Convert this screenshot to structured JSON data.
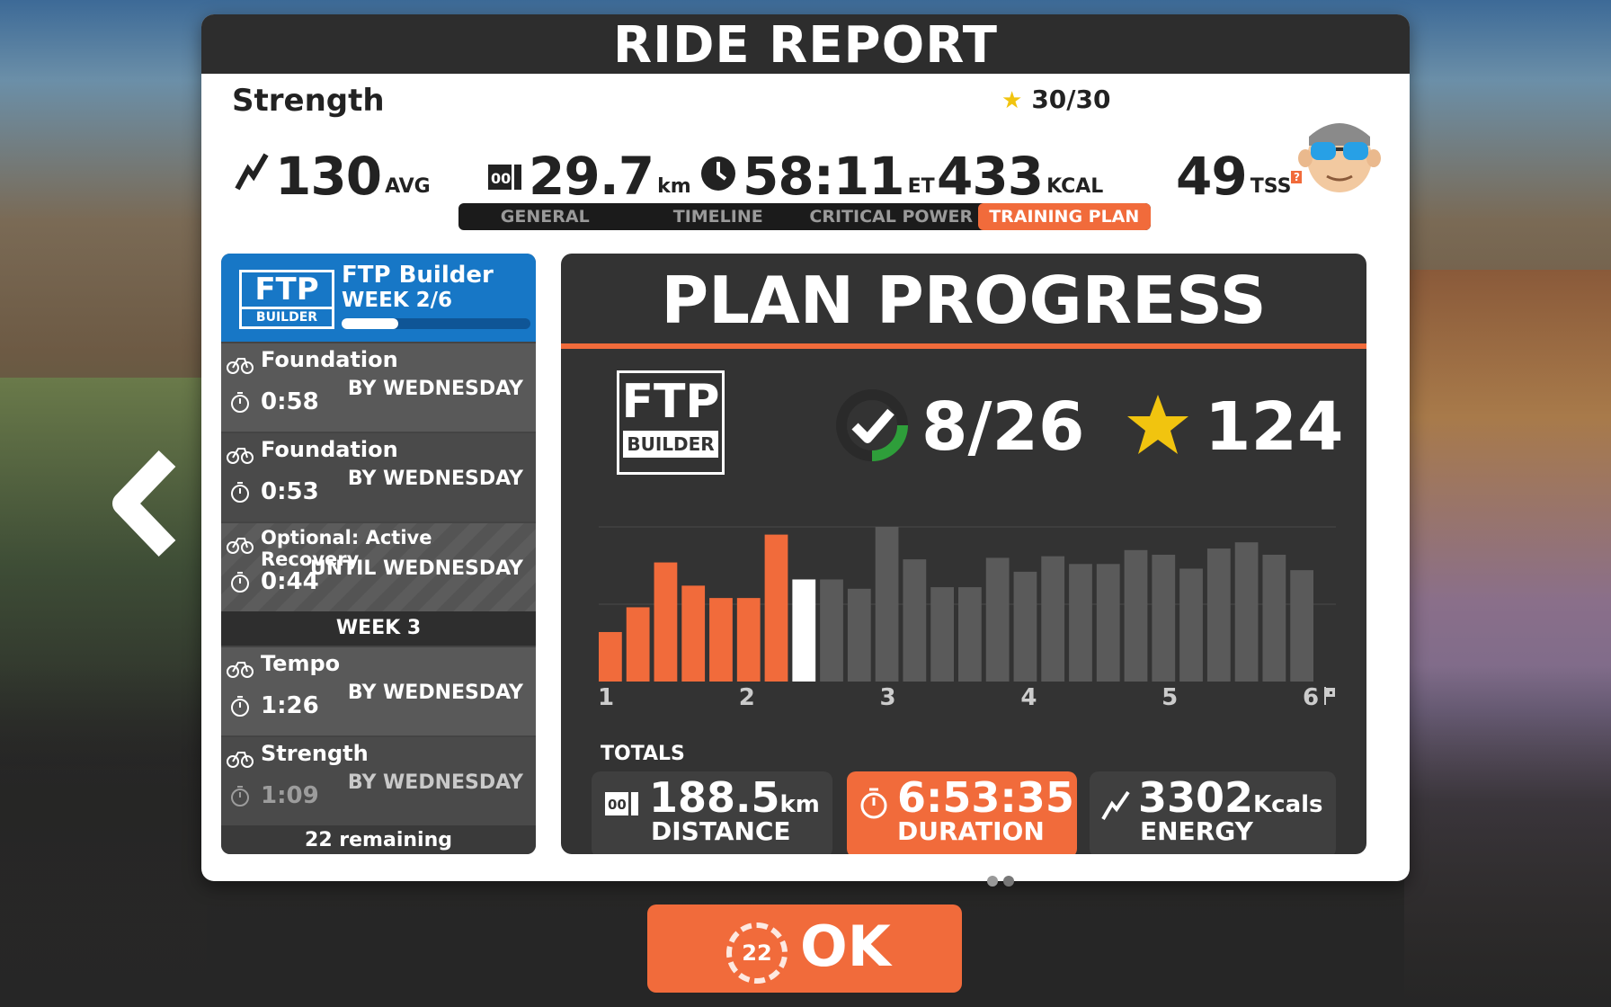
{
  "header": {
    "title": "RIDE REPORT"
  },
  "ride": {
    "workout_name": "Strength",
    "stars": "30/30",
    "power": {
      "value": "130",
      "unit": "AVG"
    },
    "distance": {
      "value": "29.7",
      "unit": "km"
    },
    "time": {
      "value": "58:11",
      "unit": "ET"
    },
    "calories": {
      "value": "433",
      "unit": "KCAL"
    },
    "tss": {
      "value": "49",
      "unit": "TSS"
    }
  },
  "tabs": [
    {
      "label": "GENERAL",
      "active": false
    },
    {
      "label": "TIMELINE",
      "active": false
    },
    {
      "label": "CRITICAL POWER",
      "active": false
    },
    {
      "label": "TRAINING PLAN",
      "active": true
    }
  ],
  "plan": {
    "logo_top": "FTP",
    "logo_bottom": "BUILDER",
    "title": "FTP Builder",
    "week": "WEEK 2/6",
    "week_progress": 0.3,
    "workouts": [
      {
        "name": "Foundation",
        "duration": "0:58",
        "due": "BY WEDNESDAY"
      },
      {
        "name": "Foundation",
        "duration": "0:53",
        "due": "BY WEDNESDAY"
      },
      {
        "name": "Optional: Active Recovery",
        "duration": "0:44",
        "due": "UNTIL WEDNESDAY"
      },
      {
        "name": "Tempo",
        "duration": "1:26",
        "due": "BY WEDNESDAY"
      },
      {
        "name": "Strength",
        "duration": "1:09",
        "due": "BY WEDNESDAY"
      }
    ],
    "week3_label": "WEEK 3",
    "remaining": "22 remaining"
  },
  "progress": {
    "title": "PLAN PROGRESS",
    "logo_top": "FTP",
    "logo_bottom": "BUILDER",
    "completed": "8/26",
    "stars": "124",
    "totals_label": "TOTALS",
    "distance": {
      "value": "188.5",
      "unit": "km",
      "label": "DISTANCE"
    },
    "duration": {
      "value": "6:53:35",
      "label": "DURATION"
    },
    "energy": {
      "value": "3302",
      "unit": "Kcals",
      "label": "ENERGY"
    }
  },
  "chart_data": {
    "type": "bar",
    "x_tick_labels": [
      "1",
      "2",
      "3",
      "4",
      "5",
      "6"
    ],
    "values": [
      0.32,
      0.48,
      0.77,
      0.62,
      0.54,
      0.54,
      0.95,
      0.66,
      0.66,
      0.6,
      1.0,
      0.79,
      0.61,
      0.61,
      0.8,
      0.71,
      0.81,
      0.76,
      0.76,
      0.85,
      0.82,
      0.73,
      0.86,
      0.9,
      0.82,
      0.72
    ],
    "completed_count": 7,
    "current_index": 7,
    "colors": {
      "completed": "#f16b3b",
      "current": "#ffffff",
      "upcoming": "#5a5a5a"
    }
  },
  "colors": {
    "accent": "#f16b3b",
    "plan_blue": "#1777c6",
    "dark": "#2d2d2d",
    "star": "#f1c40f",
    "check_green": "#2e9e3a"
  },
  "ok": {
    "label": "OK",
    "countdown": "22"
  },
  "page_dots": [
    {
      "active": true
    },
    {
      "active": false
    }
  ]
}
